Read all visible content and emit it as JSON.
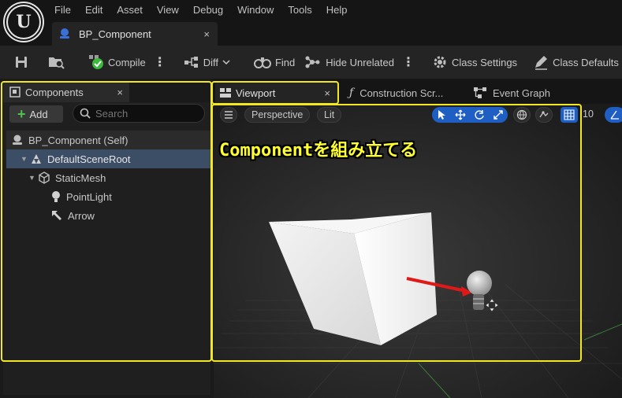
{
  "menu": [
    "File",
    "Edit",
    "Asset",
    "View",
    "Debug",
    "Window",
    "Tools",
    "Help"
  ],
  "asset_tab": {
    "label": "BP_Component",
    "close": "×"
  },
  "toolbar": {
    "compile": "Compile",
    "diff": "Diff",
    "find": "Find",
    "hide_unrelated": "Hide Unrelated",
    "class_settings": "Class Settings",
    "class_defaults": "Class Defaults"
  },
  "components_panel": {
    "tab_label": "Components",
    "close": "×",
    "add_label": "Add",
    "search_placeholder": "Search",
    "tree": [
      {
        "label": "BP_Component (Self)",
        "icon": "blueprint-self-icon"
      },
      {
        "label": "DefaultSceneRoot",
        "icon": "scene-root-icon"
      },
      {
        "label": "StaticMesh",
        "icon": "static-mesh-icon"
      },
      {
        "label": "PointLight",
        "icon": "point-light-icon"
      },
      {
        "label": "Arrow",
        "icon": "arrow-component-icon"
      }
    ]
  },
  "editor_tabs": {
    "viewport": "Viewport",
    "viewport_close": "×",
    "construction": "Construction Scr...",
    "event_graph": "Event Graph"
  },
  "viewport": {
    "perspective": "Perspective",
    "lit": "Lit",
    "grid_size": "10",
    "annotation": "Componentを組み立てる"
  },
  "colors": {
    "highlight": "#f2e81f",
    "accent_blue": "#1f5fc4",
    "selection": "#3c4e66",
    "annotation_text": "#ffff30",
    "add_plus": "#4fc24f"
  }
}
